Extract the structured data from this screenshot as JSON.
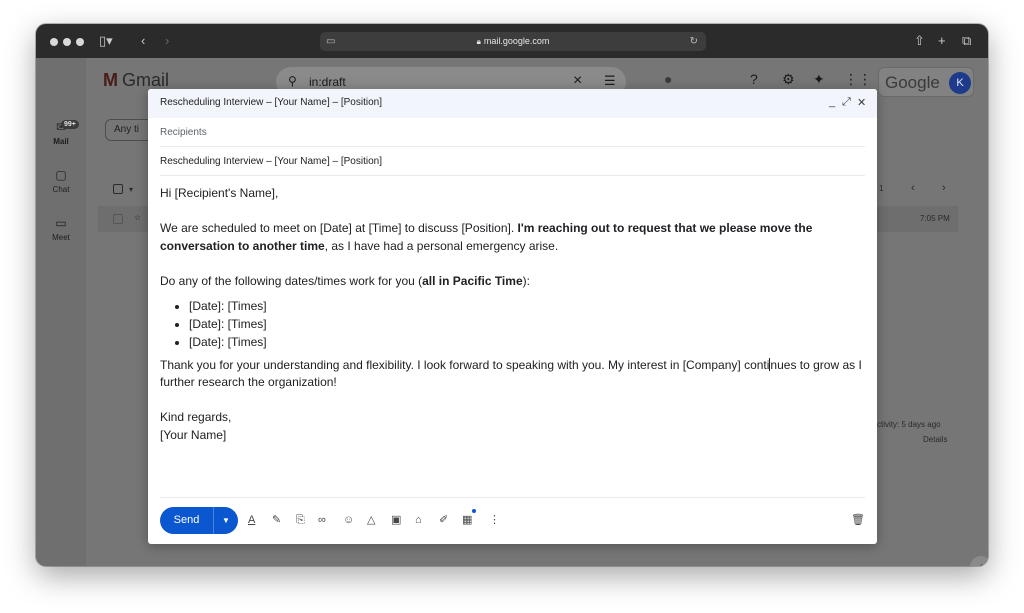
{
  "browser": {
    "url": "mail.google.com"
  },
  "gmail": {
    "logo_text": "Gmail",
    "search_value": "in:draft",
    "google_word": "Google",
    "avatar_initial": "K",
    "badge_count": "99+",
    "rail": [
      {
        "label": "Mail"
      },
      {
        "label": "Chat"
      },
      {
        "label": "Meet"
      }
    ],
    "filter_chip": "Any ti",
    "pager_count": "1",
    "row_time": "7:05 PM",
    "activity": "ctivity: 5 days ago",
    "details": "Details"
  },
  "compose": {
    "title": "Rescheduling Interview – [Your Name] – [Position]",
    "recipients_placeholder": "Recipients",
    "subject": "Rescheduling Interview – [Your Name] – [Position]",
    "greeting": "Hi [Recipient's Name],",
    "para1_start": "We are scheduled to meet on [Date] at [Time] to discuss [Position]. ",
    "para1_bold": "I'm reaching out to request that we please move the conversation to another time",
    "para1_end": ", as I have had a personal emergency arise.",
    "para2_start": "Do any of the following dates/times work for you (",
    "para2_bold": "all in Pacific Time",
    "para2_end": "):",
    "list": [
      "[Date]: [Times]",
      "[Date]: [Times]",
      "[Date]: [Times]"
    ],
    "para3_a": "Thank you for your understanding and flexibility. I look forward to speaking with you. My interest in [Company] conti",
    "para3_b": "nues to grow as I further research the organization!",
    "closing": "Kind regards,",
    "signature": "[Your Name]",
    "send_label": "Send"
  }
}
